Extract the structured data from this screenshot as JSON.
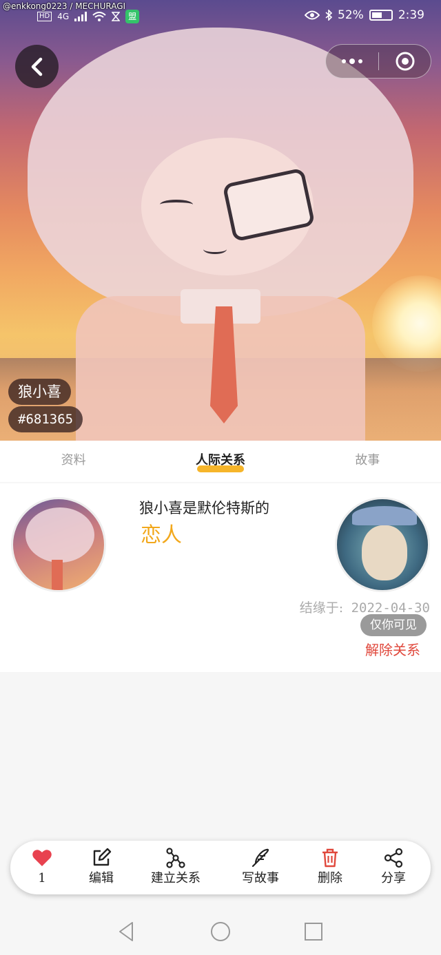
{
  "status_bar": {
    "watermark": "@enkkong0223 / MECHURAGI",
    "net_tag": "HD",
    "net_type": "4G",
    "app_badge": "盟",
    "battery": "52%",
    "time": "2:39"
  },
  "hero": {
    "name": "狼小喜",
    "id": "#681365"
  },
  "tabs": [
    {
      "label": "资料",
      "active": false
    },
    {
      "label": "人际关系",
      "active": true
    },
    {
      "label": "故事",
      "active": false
    }
  ],
  "relation": {
    "text": "狼小喜是默伦特斯的",
    "type": "恋人",
    "since_label": "结缘于:",
    "since_date": "2022-04-30",
    "visibility": "仅你可见",
    "unlink_label": "解除关系"
  },
  "toolbar": {
    "like_count": "1",
    "edit": "编辑",
    "link": "建立关系",
    "write": "写故事",
    "delete": "删除",
    "share": "分享"
  },
  "colors": {
    "accent": "#f2a81c",
    "danger": "#e0483c",
    "like": "#e8424f"
  }
}
